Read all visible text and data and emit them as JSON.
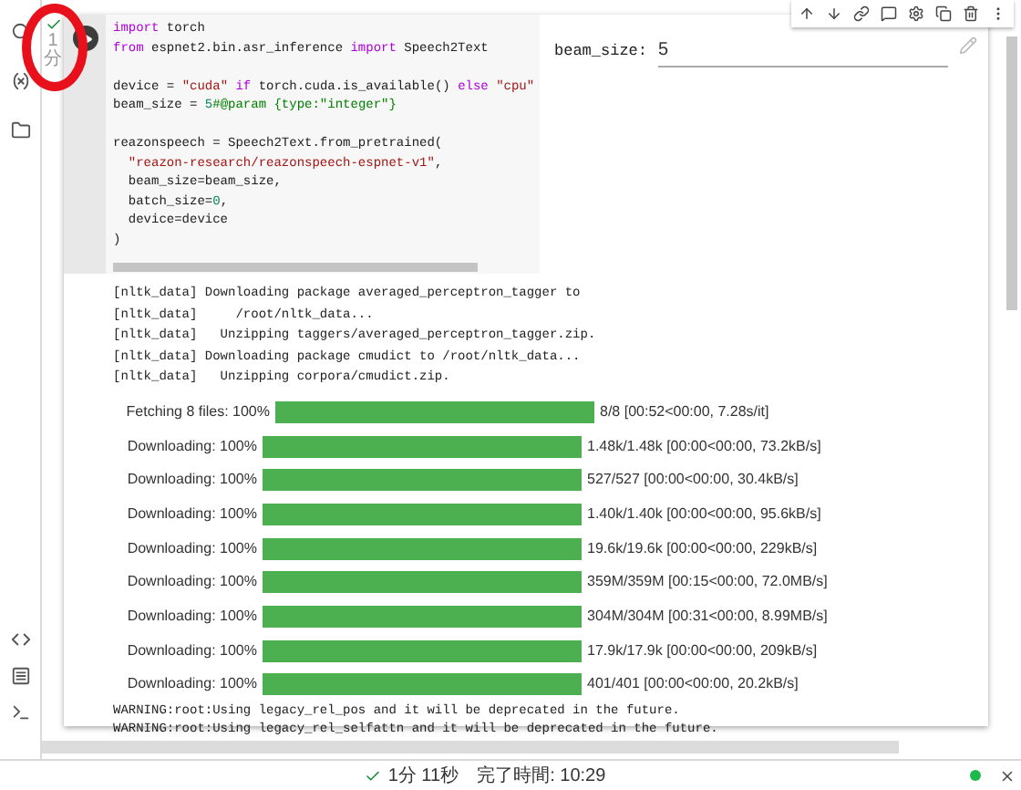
{
  "run_status": {
    "done": true,
    "elapsed": [
      "1",
      "分"
    ]
  },
  "cell_toolbar": [
    {
      "kind": "up"
    },
    {
      "kind": "down"
    },
    {
      "kind": "link"
    },
    {
      "kind": "comment"
    },
    {
      "kind": "settings"
    },
    {
      "kind": "mirror"
    },
    {
      "kind": "delete"
    },
    {
      "kind": "more"
    }
  ],
  "code_lines": [
    {
      "tokens": [
        {
          "text": "import",
          "kind": "keyword"
        },
        {
          "text": " torch",
          "kind": "plain"
        }
      ]
    },
    {
      "tokens": [
        {
          "text": "from",
          "kind": "keyword"
        },
        {
          "text": " espnet2.bin.asr_inference ",
          "kind": "plain"
        },
        {
          "text": "import",
          "kind": "keyword"
        },
        {
          "text": " Speech2Text",
          "kind": "plain"
        }
      ]
    },
    {
      "kind": "blank"
    },
    {
      "tokens": [
        {
          "text": "device = ",
          "kind": "plain"
        },
        {
          "text": "\"cuda\"",
          "kind": "string"
        },
        {
          "text": " if",
          "kind": "keyword"
        },
        {
          "text": " torch.cuda.is_available() ",
          "kind": "plain"
        },
        {
          "text": "else",
          "kind": "keyword"
        },
        {
          "text": " \"cpu\"",
          "kind": "string"
        }
      ]
    },
    {
      "tokens": [
        {
          "text": "beam_size = ",
          "kind": "plain"
        },
        {
          "text": "5",
          "kind": "number"
        },
        {
          "text": "#@param {type:\"integer\"}",
          "kind": "comment"
        }
      ]
    },
    {
      "kind": "blank"
    },
    {
      "tokens": [
        {
          "text": "reazonspeech = Speech2Text.from_pretrained(",
          "kind": "plain"
        }
      ]
    },
    {
      "tokens": [
        {
          "text": "  \"reazon-research/reazonspeech-espnet-v1\"",
          "kind": "string"
        },
        {
          "text": ",",
          "kind": "plain"
        }
      ]
    },
    {
      "tokens": [
        {
          "text": "  beam_size=beam_size,",
          "kind": "plain"
        }
      ]
    },
    {
      "tokens": [
        {
          "text": "  batch_size=",
          "kind": "plain"
        },
        {
          "text": "0",
          "kind": "number"
        },
        {
          "text": ",",
          "kind": "plain"
        }
      ]
    },
    {
      "tokens": [
        {
          "text": "  device=device",
          "kind": "plain"
        }
      ]
    },
    {
      "tokens": [
        {
          "text": ")",
          "kind": "plain"
        }
      ]
    }
  ],
  "form": {
    "label": "beam_size:",
    "value": "5"
  },
  "log_lines": [
    "[nltk_data] Downloading package averaged_perceptron_tagger to",
    "[nltk_data]     /root/nltk_data...",
    "[nltk_data]   Unzipping taggers/averaged_perceptron_tagger.zip.",
    "[nltk_data] Downloading package cmudict to /root/nltk_data...",
    "[nltk_data]   Unzipping corpora/cmudict.zip."
  ],
  "progress": [
    {
      "label": "Fetching 8 files: 100%",
      "level": 1,
      "stats": "8/8 [00:52<00:00, 7.28s/it]"
    },
    {
      "label": "Downloading: 100%",
      "level": 1,
      "stats": "1.48k/1.48k [00:00<00:00, 73.2kB/s]"
    },
    {
      "label": "Downloading: 100%",
      "level": 1,
      "stats": "527/527 [00:00<00:00, 30.4kB/s]"
    },
    {
      "label": "Downloading: 100%",
      "level": 1,
      "stats": "1.40k/1.40k [00:00<00:00, 95.6kB/s]"
    },
    {
      "label": "Downloading: 100%",
      "level": 1,
      "stats": "19.6k/19.6k [00:00<00:00, 229kB/s]"
    },
    {
      "label": "Downloading: 100%",
      "level": 1,
      "stats": "359M/359M [00:15<00:00, 72.0MB/s]"
    },
    {
      "label": "Downloading: 100%",
      "level": 1,
      "stats": "304M/304M [00:31<00:00, 8.99MB/s]"
    },
    {
      "label": "Downloading: 100%",
      "level": 1,
      "stats": "17.9k/17.9k [00:00<00:00, 209kB/s]"
    },
    {
      "label": "Downloading: 100%",
      "level": 1,
      "stats": "401/401 [00:00<00:00, 20.2kB/s]"
    }
  ],
  "warnings": [
    "WARNING:root:Using legacy_rel_pos and it will be deprecated in the future.",
    "WARNING:root:Using legacy_rel_selfattn and it will be deprecated in the future."
  ],
  "status_bar": {
    "done": true,
    "duration": "1分 11秒",
    "finished": "完了時間: 10:29",
    "connected": true
  }
}
